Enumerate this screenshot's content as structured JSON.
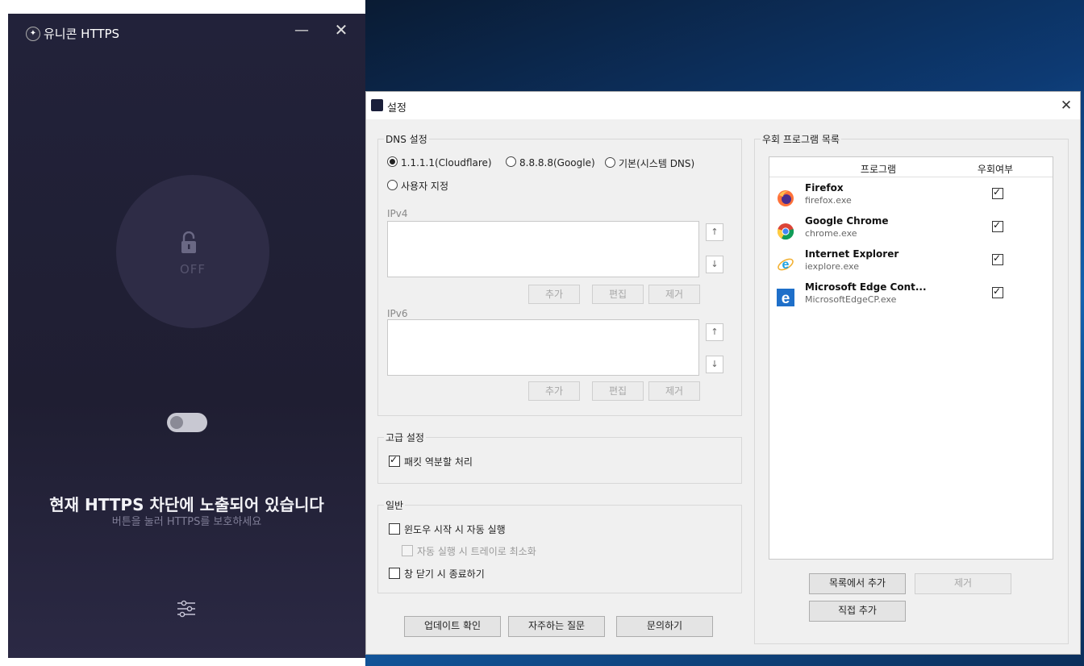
{
  "unicorn": {
    "title": "유니콘 HTTPS",
    "minimize": "—",
    "close": "✕",
    "power_state": "OFF",
    "status_main": "현재 HTTPS 차단에 노출되어 있습니다",
    "status_sub": "버튼을 눌러 HTTPS를 보호하세요"
  },
  "dialog": {
    "title": "설정",
    "close": "✕",
    "dns": {
      "group_label": "DNS 설정",
      "options": [
        "1.1.1.1(Cloudflare)",
        "8.8.8.8(Google)",
        "기본(시스템 DNS)",
        "사용자 지정"
      ],
      "selected": "1.1.1.1(Cloudflare)",
      "ipv4_label": "IPv4",
      "ipv6_label": "IPv6",
      "up": "↑",
      "down": "↓",
      "add": "추가",
      "edit": "편집",
      "remove": "제거"
    },
    "advanced": {
      "group_label": "고급 설정",
      "packet_fragment": "패킷 역분할 처리"
    },
    "general": {
      "group_label": "일반",
      "auto_start": "윈도우 시작 시 자동 실행",
      "minimize_tray": "자동 실행 시 트레이로 최소화",
      "close_exit": "창 닫기 시 종료하기"
    },
    "bottom_buttons": {
      "update": "업데이트 확인",
      "faq": "자주하는 질문",
      "contact": "문의하기"
    },
    "bypass": {
      "group_label": "우회 프로그램 목록",
      "col_program": "프로그램",
      "col_bypass": "우회여부",
      "programs": [
        {
          "name": "Firefox",
          "exe": "firefox.exe",
          "icon": "firefox-icon"
        },
        {
          "name": "Google Chrome",
          "exe": "chrome.exe",
          "icon": "chrome-icon"
        },
        {
          "name": "Internet Explorer",
          "exe": "iexplore.exe",
          "icon": "ie-icon"
        },
        {
          "name": "Microsoft Edge Cont...",
          "exe": "MicrosoftEdgeCP.exe",
          "icon": "edge-icon"
        }
      ],
      "add_from_list": "목록에서 추가",
      "remove": "제거",
      "add_direct": "직접 추가"
    }
  }
}
